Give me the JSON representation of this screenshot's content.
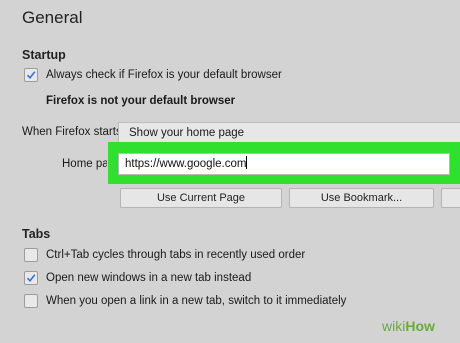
{
  "page": {
    "title": "General"
  },
  "startup": {
    "heading": "Startup",
    "default_browser_check_label": "Always check if Firefox is your default browser",
    "default_browser_check_checked": true,
    "default_browser_status": "Firefox is not your default browser",
    "when_starts_label": "When Firefox starts",
    "when_starts_value": "Show your home page",
    "home_page_label": "Home page",
    "home_page_value": "https://www.google.com",
    "use_current_page_label": "Use Current Page",
    "use_bookmark_label": "Use Bookmark..."
  },
  "tabs": {
    "heading": "Tabs",
    "options": [
      {
        "label": "Ctrl+Tab cycles through tabs in recently used order",
        "checked": false
      },
      {
        "label": "Open new windows in a new tab instead",
        "checked": true
      },
      {
        "label": "When you open a link in a new tab, switch to it immediately",
        "checked": false
      }
    ]
  },
  "watermark": {
    "prefix": "wiki",
    "suffix": "How"
  },
  "colors": {
    "background": "#d3d3d3",
    "highlight": "#2fe02f",
    "check": "#3a6fd8",
    "watermark": "#6aaa3b"
  },
  "icons": {
    "check": "checkmark-icon"
  }
}
